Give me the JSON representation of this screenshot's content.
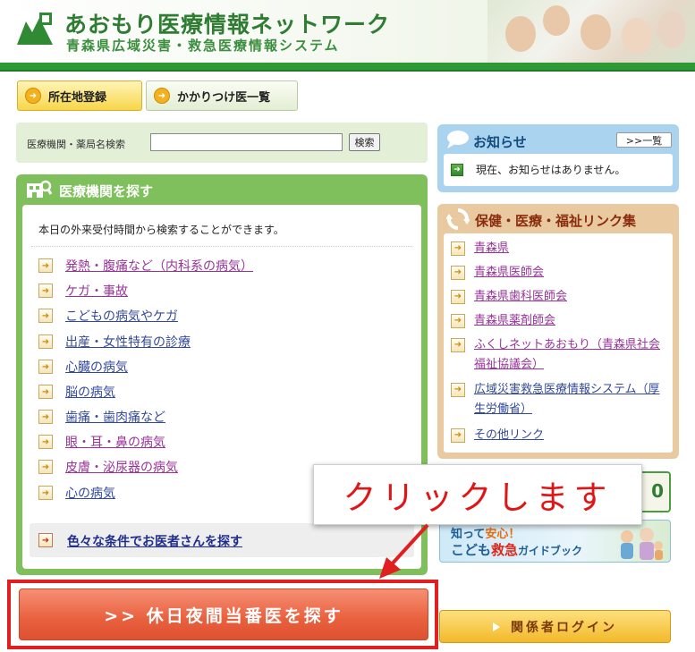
{
  "header": {
    "title": "あおもり医療情報ネットワーク",
    "subtitle": "青森県広域災害・救急医療情報システム"
  },
  "top_buttons": {
    "location": "所在地登録",
    "family_doctor": "かかりつけ医一覧"
  },
  "search": {
    "label": "医療機関・薬局名検索",
    "value": "",
    "button": "検索"
  },
  "main": {
    "title": "医療機関を探す",
    "intro": "本日の外来受付時間から検索することができます。",
    "categories": [
      {
        "label": "発熱・腹痛など（内科系の病気）",
        "visited": true
      },
      {
        "label": "ケガ・事故",
        "visited": true
      },
      {
        "label": "こどもの病気やケガ",
        "visited": false
      },
      {
        "label": "出産・女性特有の診療",
        "visited": false
      },
      {
        "label": "心臓の病気",
        "visited": false
      },
      {
        "label": "脳の病気",
        "visited": false
      },
      {
        "label": "歯痛・歯肉痛など",
        "visited": false
      },
      {
        "label": "眼・耳・鼻の病気",
        "visited": true
      },
      {
        "label": "皮膚・泌尿器の病気",
        "visited": true
      },
      {
        "label": "心の病気",
        "visited": false
      }
    ],
    "conditions_link": "色々な条件でお医者さんを探す"
  },
  "holiday_button": ">>  休日夜間当番医を探す",
  "notices": {
    "title": "お知らせ",
    "list_button": ">>一覧",
    "message": "現在、お知らせはありません。"
  },
  "links": {
    "title": "保健・医療・福祉リンク集",
    "items": [
      "青森県",
      "青森県医師会",
      "青森県歯科医師会",
      "青森県薬剤師会",
      "ふくしネットあおもり（青森県社会福祉協議会）",
      "広域災害救急医療情報システム（厚生労働省）",
      "その他リンク"
    ]
  },
  "banner1": {
    "partial_text": "0"
  },
  "banner2": {
    "line1a": "知って",
    "line1b": "安心！",
    "line2a": "こども",
    "line2b": "救急",
    "line2c": "ガイドブック"
  },
  "login_button": "関係者ログイン",
  "annotation": {
    "text": "クリックします",
    "color": "#e02020"
  },
  "colors": {
    "brand_green": "#2f9a35",
    "accent_orange": "#e9603e",
    "link_visited": "#993399",
    "link": "#334a9a"
  }
}
